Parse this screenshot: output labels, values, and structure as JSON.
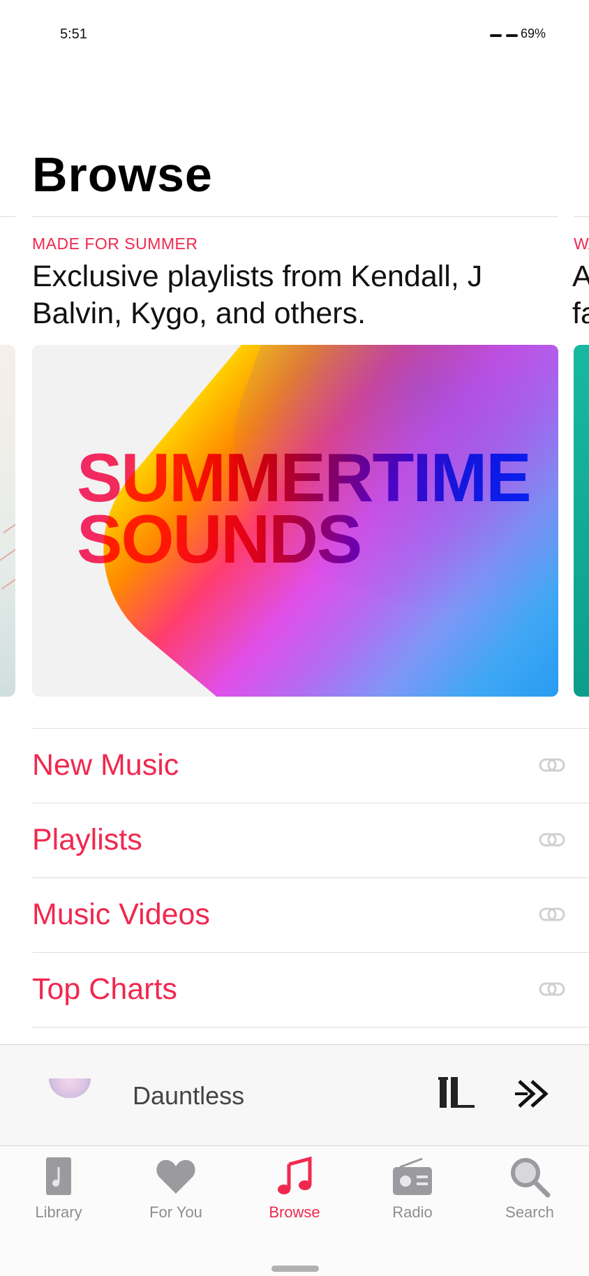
{
  "status_bar": {
    "time": "5:51",
    "battery": "69%"
  },
  "page": {
    "title": "Browse"
  },
  "featured": {
    "eyebrow": "MADE FOR SUMMER",
    "headline": "Exclusive playlists from Kendall, J Balvin, Kygo, and others.",
    "hero_line1": "SUMMERTIME",
    "hero_line2": "SOUNDS",
    "next_eyebrow": "WA",
    "next_headline_line1": "A",
    "next_headline_line2": "fa"
  },
  "sections": [
    {
      "label": "New Music"
    },
    {
      "label": "Playlists"
    },
    {
      "label": "Music Videos"
    },
    {
      "label": "Top Charts"
    }
  ],
  "now_playing": {
    "title": "Dauntless"
  },
  "tabs": [
    {
      "label": "Library",
      "icon": "library-icon"
    },
    {
      "label": "For You",
      "icon": "heart-icon"
    },
    {
      "label": "Browse",
      "icon": "music-note-icon",
      "active": true
    },
    {
      "label": "Radio",
      "icon": "radio-icon"
    },
    {
      "label": "Search",
      "icon": "search-icon"
    }
  ],
  "colors": {
    "accent": "#f0284f",
    "inactive": "#8e8e93"
  }
}
